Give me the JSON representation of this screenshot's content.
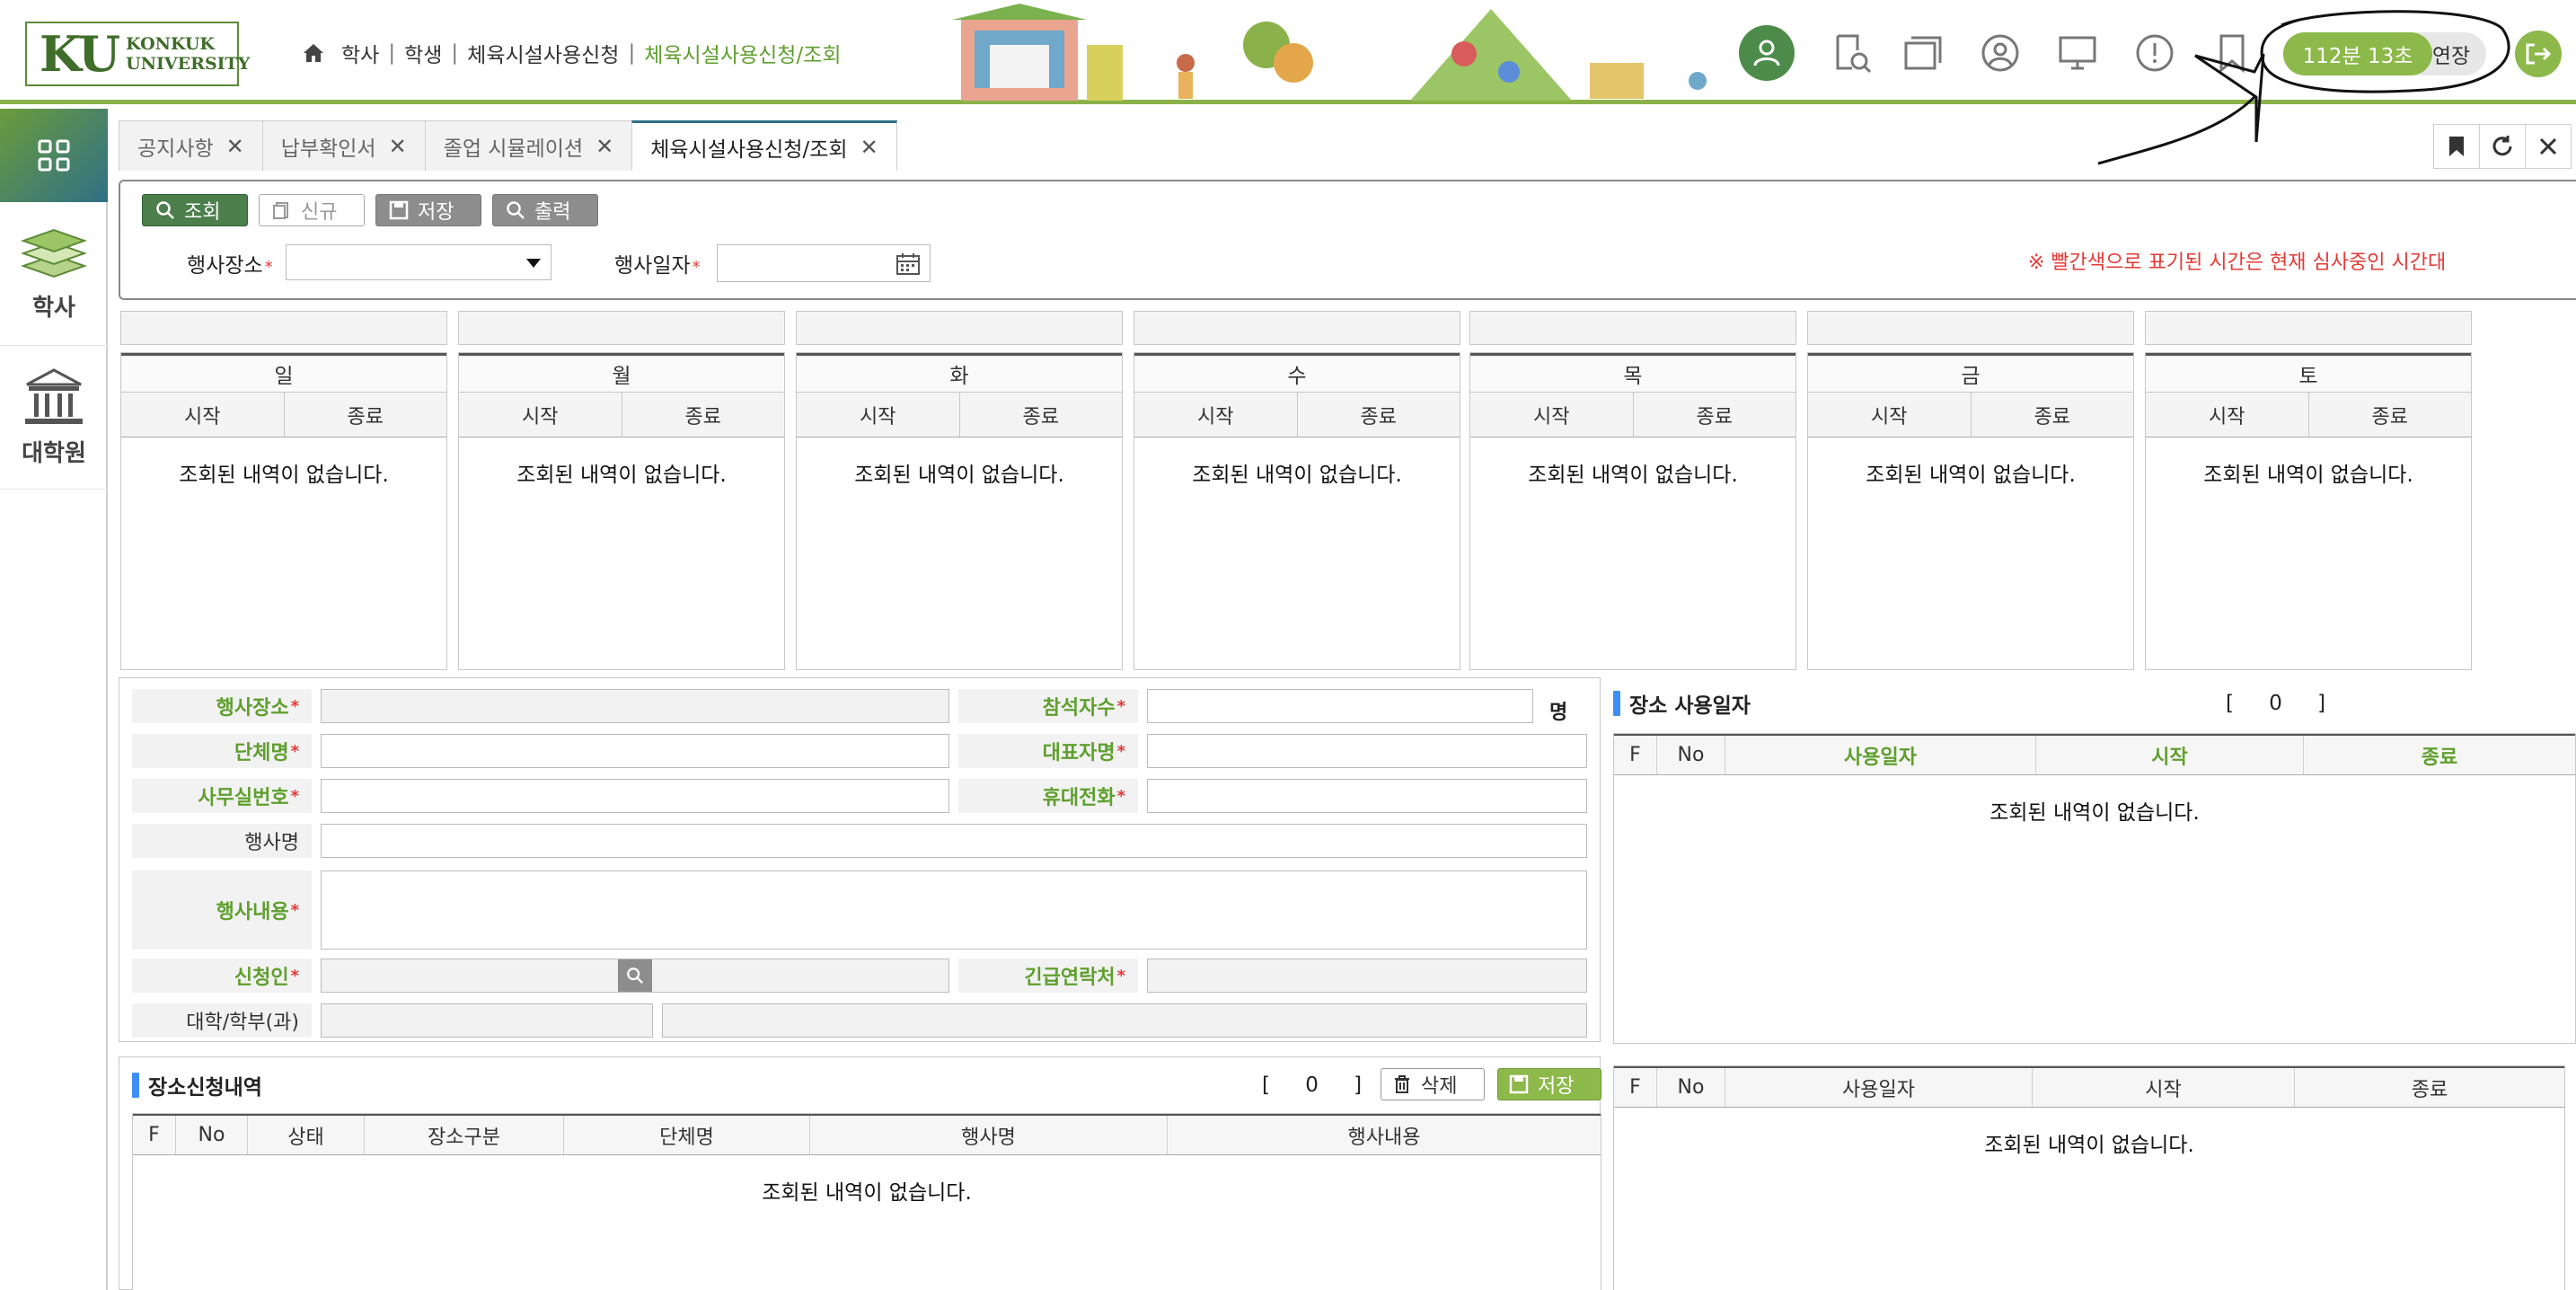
{
  "header": {
    "logo_ku": "KU",
    "logo_text1": "KONKUK",
    "logo_text2": "UNIVERSITY",
    "breadcrumb": [
      "학사",
      "학생",
      "체육시설사용신청",
      "체육시설사용신청/조회"
    ],
    "timer": "112분 13초",
    "extend": "연장",
    "icons": [
      "user-icon",
      "search-doc-icon",
      "windows-icon",
      "profile-icon",
      "monitor-icon",
      "alert-icon",
      "bookmark-icon"
    ],
    "accent": "#8db84a"
  },
  "sidebar": {
    "items": [
      {
        "label": "학사",
        "icon": "books-icon"
      },
      {
        "label": "대학원",
        "icon": "building-icon"
      }
    ]
  },
  "tabs": [
    {
      "label": "공지사항"
    },
    {
      "label": "납부확인서"
    },
    {
      "label": "졸업 시뮬레이션"
    },
    {
      "label": "체육시설사용신청/조회",
      "active": true
    }
  ],
  "toolbar": {
    "search_label": "조회",
    "new_label": "신규",
    "save_label": "저장",
    "print_label": "출력"
  },
  "filters": {
    "place_label": "행사장소",
    "date_label": "행사일자",
    "notice": "※ 빨간색으로 표기된 시간은 현재 심사중인 시간대"
  },
  "calendar": {
    "days": [
      "일",
      "월",
      "화",
      "수",
      "목",
      "금",
      "토"
    ],
    "start_label": "시작",
    "end_label": "종료",
    "empty": "조회된 내역이 없습니다."
  },
  "form": {
    "place": "행사장소",
    "attendees": "참석자수",
    "attendees_unit": "명",
    "group": "단체명",
    "representative": "대표자명",
    "office_phone": "사무실번호",
    "mobile": "휴대전화",
    "event_name": "행사명",
    "event_content": "행사내용",
    "applicant": "신청인",
    "emergency": "긴급연락처",
    "college": "대학/학부(과)"
  },
  "usage_panel": {
    "title": "장소 사용일자",
    "count": "0",
    "columns": [
      "F",
      "No",
      "사용일자",
      "시작",
      "종료"
    ],
    "empty": "조회된 내역이 없습니다."
  },
  "apply_list": {
    "title": "장소신청내역",
    "count": "0",
    "delete_label": "삭제",
    "save_label": "저장",
    "columns": [
      "F",
      "No",
      "상태",
      "장소구분",
      "단체명",
      "행사명",
      "행사내용"
    ],
    "empty": "조회된 내역이 없습니다."
  },
  "usage_panel2": {
    "columns": [
      "F",
      "No",
      "사용일자",
      "시작",
      "종료"
    ],
    "empty": "조회된 내역이 없습니다."
  }
}
